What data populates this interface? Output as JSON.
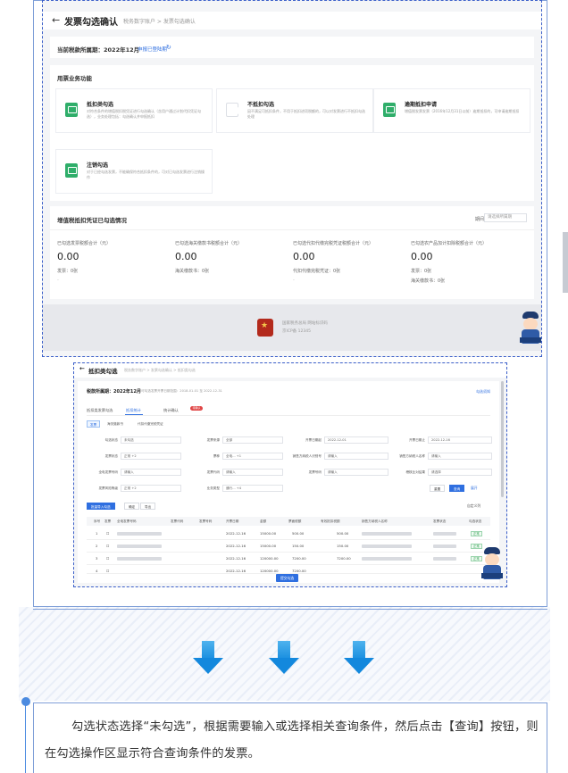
{
  "screenshot1": {
    "title": "发票勾选确认",
    "breadcrumb": "税务数字账户 > 发票勾选确认",
    "period_label": "当前税款所属期：2022年12月",
    "period_link": "申报已登陆期",
    "section_title": "用票业务功能",
    "functions": [
      {
        "name": "抵扣类勾选",
        "desc": "对符合条件的增值税扣税凭证进行勾选确认（含用户通过计划代扣凭证勾选），业务处理包括：勾选确认并申报抵扣"
      },
      {
        "name": "不抵扣勾选",
        "desc": "因不满足可抵扣条件，不用于抵扣进项税额的，可以对发票进行不抵扣勾选处理"
      },
      {
        "name": "逾期抵扣申请",
        "desc": "增值税发票发票（2016年12月31日以前）逾期抵扣的，可申请逾期抵扣"
      },
      {
        "name": "注销勾选",
        "desc": "对于已经勾选发票，不能确保符合抵扣条件的，可对已勾选发票进行注销操作"
      }
    ],
    "stats_title": "增值税抵扣凭证已勾选情况",
    "stats_dropdown": "请选择所属期",
    "stats_dropdown_label": "期间",
    "stats": [
      {
        "label": "已勾选发票税额合计（元）",
        "value": "0.00",
        "sub1": "发票：0张",
        "sub2": "-"
      },
      {
        "label": "已勾选海关缴款书税额合计（元）",
        "value": "0.00",
        "sub1": "海关缴款书：0张",
        "sub2": ""
      },
      {
        "label": "已勾选代扣代缴完税凭证税额合计（元）",
        "value": "0.00",
        "sub1": "代扣代缴完税凭证：0张",
        "sub2": "-"
      },
      {
        "label": "已勾选农产品加计扣除税额合计（元）",
        "value": "0.00",
        "sub1": "发票：0张",
        "sub2": "海关缴款书：0张"
      }
    ],
    "footer_line1": "国家税务总局 网站标识码",
    "footer_line2": "京ICP备 12345"
  },
  "screenshot2": {
    "title": "抵扣类勾选",
    "breadcrumb": "税务数字账户 > 发票勾选确认 > 抵扣类勾选",
    "period_label": "税款所属期：2022年12月",
    "period_note": "当前可勾选发票开票日期范围：2018-01-01 至 2022-12-31",
    "help_link": "勾选须知",
    "tabs": [
      "抵扣类发票勾选",
      "抵扣统计",
      "统计确认"
    ],
    "tab_badge": "待确认",
    "chips": [
      "发票",
      "海关缴款书",
      "代扣代缴完税凭证"
    ],
    "fields": [
      {
        "label": "勾选状态",
        "value": "未勾选"
      },
      {
        "label": "发票来源",
        "value": "全部"
      },
      {
        "label": "开票日期起",
        "value": "2022-12-01"
      },
      {
        "label": "开票日期止",
        "value": "2022-12-16"
      },
      {
        "label": "发票状态",
        "value": "正常  +2"
      },
      {
        "label": "票种",
        "value": "全电... +1"
      },
      {
        "label": "销售方纳税人识别号",
        "value": "请输入"
      },
      {
        "label": "销售方纳税人名称",
        "value": "请输入"
      },
      {
        "label": "全电发票号码",
        "value": "请输入"
      },
      {
        "label": "发票代码",
        "value": "请输入"
      },
      {
        "label": "发票号码",
        "value": "请输入"
      },
      {
        "label": "稽核比对结果",
        "value": "请选择"
      },
      {
        "label": "发票风险等级",
        "value": "正常  +2"
      },
      {
        "label": "业务类型",
        "value": "通行... +4"
      }
    ],
    "buttons": {
      "import": "批量导入勾选",
      "confirm_row": "确定",
      "export": "导出",
      "reset": "重置",
      "query": "查询",
      "expand": "展开",
      "column_set": "自定义列"
    },
    "table_headers": [
      "序号",
      "发票",
      "全电发票号码",
      "发票代码",
      "发票号码",
      "开票日期",
      "金额",
      "票面税额",
      "有效抵扣税额",
      "销售方纳税人名称",
      "发票状态",
      "勾选状态"
    ],
    "rows": [
      {
        "no": "1",
        "date": "2022-12-16",
        "amount": "15000.00",
        "tax": "500.00",
        "valid_tax": "500.00",
        "status": "正常"
      },
      {
        "no": "2",
        "date": "2022-12-16",
        "amount": "15000.00",
        "tax": "150.00",
        "valid_tax": "150.00",
        "status": "正常"
      },
      {
        "no": "3",
        "date": "2022-12-16",
        "amount": "120000.00",
        "tax": "7200.00",
        "valid_tax": "7200.00",
        "status": "正常"
      },
      {
        "no": "4",
        "date": "2022-12-16",
        "amount": "120000.00",
        "tax": "7200.00",
        "valid_tax": "7200.00",
        "status": "正常"
      }
    ],
    "submit": "提交勾选"
  },
  "note": "勾选状态选择“未勾选”，根据需要输入或选择相关查询条件，然后点击【查询】按钮，则在勾选操作区显示符合查询条件的发票。",
  "colors": {
    "frame": "#7f9fd8",
    "dashed": "#3b5fc9",
    "arrow": "#1a8fe0",
    "accent": "#2f6fe0",
    "func_icon": "#2fae6a"
  }
}
